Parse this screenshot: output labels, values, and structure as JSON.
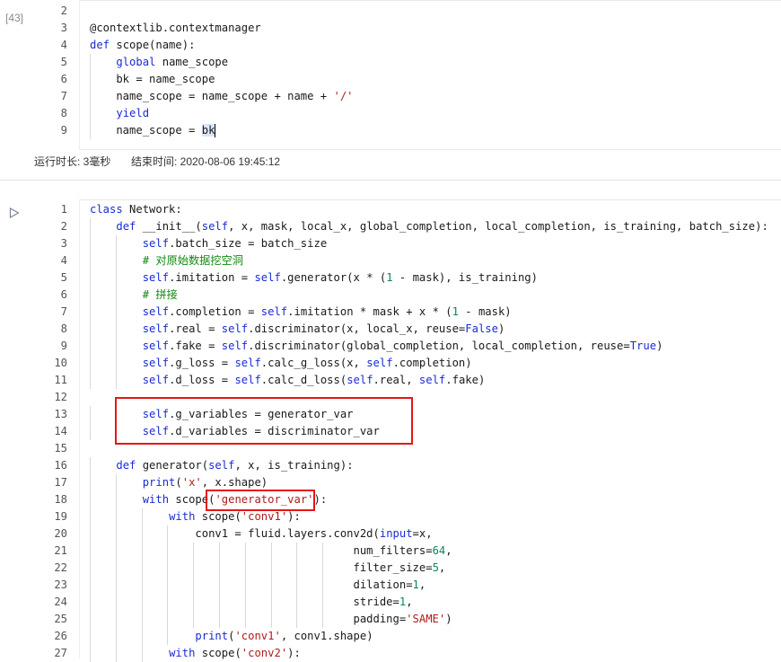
{
  "cell1": {
    "execution_count": "[43]",
    "lines": [
      {
        "no": "2",
        "tokens": []
      },
      {
        "no": "3",
        "tokens": [
          {
            "t": "@contextlib.contextmanager"
          }
        ]
      },
      {
        "no": "4",
        "tokens": [
          {
            "t": "def",
            "c": "kw"
          },
          {
            "t": " scope(name):"
          }
        ]
      },
      {
        "no": "5",
        "tokens": [
          {
            "t": "    "
          },
          {
            "t": "global",
            "c": "kw"
          },
          {
            "t": " name_scope"
          }
        ]
      },
      {
        "no": "6",
        "tokens": [
          {
            "t": "    bk = name_scope"
          }
        ]
      },
      {
        "no": "7",
        "tokens": [
          {
            "t": "    name_scope = name_scope + name + "
          },
          {
            "t": "'/'",
            "c": "str"
          }
        ]
      },
      {
        "no": "8",
        "tokens": [
          {
            "t": "    "
          },
          {
            "t": "yield",
            "c": "kw"
          }
        ]
      },
      {
        "no": "9",
        "tokens": [
          {
            "t": "    name_scope = "
          },
          {
            "t": "bk",
            "c": "cursorword"
          }
        ]
      }
    ],
    "status": {
      "runtime_label": "运行时长: 3毫秒",
      "end_time_label": "结束时间: 2020-08-06 19:45:12"
    }
  },
  "cell2": {
    "run_icon": "play-triangle-icon",
    "lines": [
      {
        "no": "1",
        "tokens": [
          {
            "t": "class",
            "c": "kw"
          },
          {
            "t": " Network:"
          }
        ]
      },
      {
        "no": "2",
        "tokens": [
          {
            "t": "    "
          },
          {
            "t": "def",
            "c": "kw"
          },
          {
            "t": " __init__("
          },
          {
            "t": "self",
            "c": "self"
          },
          {
            "t": ", x, mask, local_x, global_completion, local_completion, is_training, batch_size):"
          }
        ]
      },
      {
        "no": "3",
        "tokens": [
          {
            "t": "        "
          },
          {
            "t": "self",
            "c": "self"
          },
          {
            "t": ".batch_size = batch_size"
          }
        ]
      },
      {
        "no": "4",
        "tokens": [
          {
            "t": "        "
          },
          {
            "t": "# 对原始数据挖空洞",
            "c": "cm"
          }
        ]
      },
      {
        "no": "5",
        "tokens": [
          {
            "t": "        "
          },
          {
            "t": "self",
            "c": "self"
          },
          {
            "t": ".imitation = "
          },
          {
            "t": "self",
            "c": "self"
          },
          {
            "t": ".generator(x * ("
          },
          {
            "t": "1",
            "c": "num"
          },
          {
            "t": " - mask), is_training)"
          }
        ]
      },
      {
        "no": "6",
        "tokens": [
          {
            "t": "        "
          },
          {
            "t": "# 拼接",
            "c": "cm"
          }
        ]
      },
      {
        "no": "7",
        "tokens": [
          {
            "t": "        "
          },
          {
            "t": "self",
            "c": "self"
          },
          {
            "t": ".completion = "
          },
          {
            "t": "self",
            "c": "self"
          },
          {
            "t": ".imitation * mask + x * ("
          },
          {
            "t": "1",
            "c": "num"
          },
          {
            "t": " - mask)"
          }
        ]
      },
      {
        "no": "8",
        "tokens": [
          {
            "t": "        "
          },
          {
            "t": "self",
            "c": "self"
          },
          {
            "t": ".real = "
          },
          {
            "t": "self",
            "c": "self"
          },
          {
            "t": ".discriminator(x, local_x, reuse="
          },
          {
            "t": "False",
            "c": "bool"
          },
          {
            "t": ")"
          }
        ]
      },
      {
        "no": "9",
        "tokens": [
          {
            "t": "        "
          },
          {
            "t": "self",
            "c": "self"
          },
          {
            "t": ".fake = "
          },
          {
            "t": "self",
            "c": "self"
          },
          {
            "t": ".discriminator(global_completion, local_completion, reuse="
          },
          {
            "t": "True",
            "c": "bool"
          },
          {
            "t": ")"
          }
        ]
      },
      {
        "no": "10",
        "tokens": [
          {
            "t": "        "
          },
          {
            "t": "self",
            "c": "self"
          },
          {
            "t": ".g_loss = "
          },
          {
            "t": "self",
            "c": "self"
          },
          {
            "t": ".calc_g_loss(x, "
          },
          {
            "t": "self",
            "c": "self"
          },
          {
            "t": ".completion)"
          }
        ]
      },
      {
        "no": "11",
        "tokens": [
          {
            "t": "        "
          },
          {
            "t": "self",
            "c": "self"
          },
          {
            "t": ".d_loss = "
          },
          {
            "t": "self",
            "c": "self"
          },
          {
            "t": ".calc_d_loss("
          },
          {
            "t": "self",
            "c": "self"
          },
          {
            "t": ".real, "
          },
          {
            "t": "self",
            "c": "self"
          },
          {
            "t": ".fake)"
          }
        ]
      },
      {
        "no": "12",
        "tokens": []
      },
      {
        "no": "13",
        "tokens": [
          {
            "t": "        "
          },
          {
            "t": "self",
            "c": "self"
          },
          {
            "t": ".g_variables = generator_var"
          }
        ]
      },
      {
        "no": "14",
        "tokens": [
          {
            "t": "        "
          },
          {
            "t": "self",
            "c": "self"
          },
          {
            "t": ".d_variables = discriminator_var"
          }
        ]
      },
      {
        "no": "15",
        "tokens": []
      },
      {
        "no": "16",
        "tokens": [
          {
            "t": "    "
          },
          {
            "t": "def",
            "c": "kw"
          },
          {
            "t": " generator("
          },
          {
            "t": "self",
            "c": "self"
          },
          {
            "t": ", x, is_training):"
          }
        ]
      },
      {
        "no": "17",
        "tokens": [
          {
            "t": "        "
          },
          {
            "t": "print",
            "c": "kw"
          },
          {
            "t": "("
          },
          {
            "t": "'x'",
            "c": "str"
          },
          {
            "t": ", x.shape)"
          }
        ]
      },
      {
        "no": "18",
        "tokens": [
          {
            "t": "        "
          },
          {
            "t": "with",
            "c": "kw"
          },
          {
            "t": " scope("
          },
          {
            "t": "'generator_var'",
            "c": "str"
          },
          {
            "t": "):"
          }
        ]
      },
      {
        "no": "19",
        "tokens": [
          {
            "t": "            "
          },
          {
            "t": "with",
            "c": "kw"
          },
          {
            "t": " scope("
          },
          {
            "t": "'conv1'",
            "c": "str"
          },
          {
            "t": "):"
          }
        ]
      },
      {
        "no": "20",
        "tokens": [
          {
            "t": "                conv1 = fluid.layers.conv2d("
          },
          {
            "t": "input",
            "c": "kw"
          },
          {
            "t": "=x,"
          }
        ]
      },
      {
        "no": "21",
        "tokens": [
          {
            "t": "                                        num_filters="
          },
          {
            "t": "64",
            "c": "num"
          },
          {
            "t": ","
          }
        ]
      },
      {
        "no": "22",
        "tokens": [
          {
            "t": "                                        filter_size="
          },
          {
            "t": "5",
            "c": "num"
          },
          {
            "t": ","
          }
        ]
      },
      {
        "no": "23",
        "tokens": [
          {
            "t": "                                        dilation="
          },
          {
            "t": "1",
            "c": "num"
          },
          {
            "t": ","
          }
        ]
      },
      {
        "no": "24",
        "tokens": [
          {
            "t": "                                        stride="
          },
          {
            "t": "1",
            "c": "num"
          },
          {
            "t": ","
          }
        ]
      },
      {
        "no": "25",
        "tokens": [
          {
            "t": "                                        padding="
          },
          {
            "t": "'SAME'",
            "c": "str"
          },
          {
            "t": ")"
          }
        ]
      },
      {
        "no": "26",
        "tokens": [
          {
            "t": "                "
          },
          {
            "t": "print",
            "c": "kw"
          },
          {
            "t": "("
          },
          {
            "t": "'conv1'",
            "c": "str"
          },
          {
            "t": ", conv1.shape)"
          }
        ]
      },
      {
        "no": "27",
        "tokens": [
          {
            "t": "            "
          },
          {
            "t": "with",
            "c": "kw"
          },
          {
            "t": " scope("
          },
          {
            "t": "'conv2'",
            "c": "str"
          },
          {
            "t": "):"
          }
        ]
      }
    ]
  },
  "colors": {
    "keyword": "#1a2bd4",
    "string": "#b01b1b",
    "number": "#098658",
    "comment": "#108a10",
    "highlight_box": "#e51616"
  }
}
